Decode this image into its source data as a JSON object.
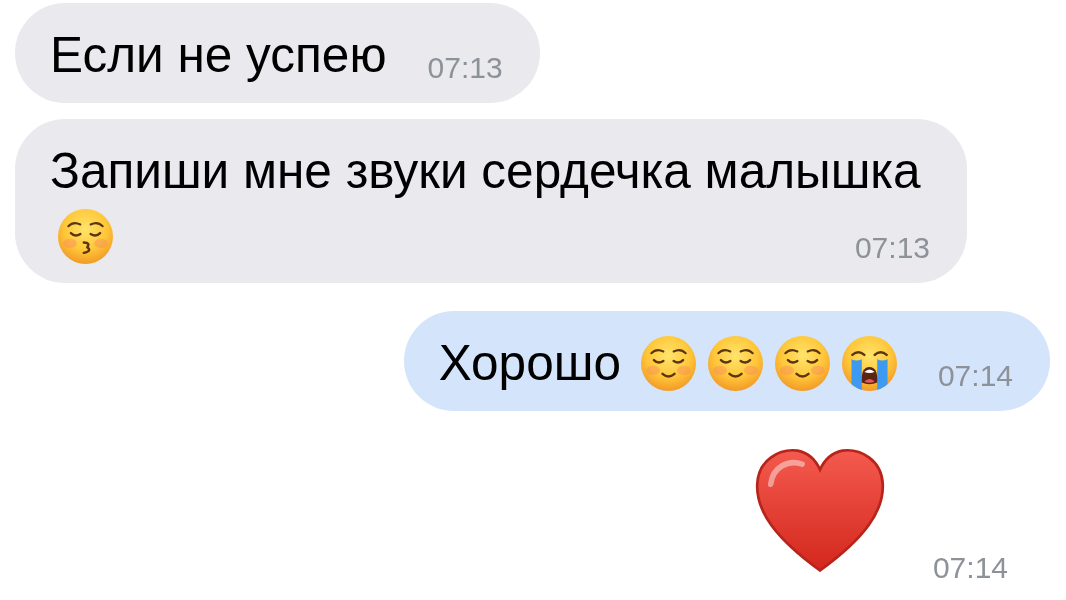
{
  "messages": [
    {
      "outgoing": false,
      "kind": "text",
      "text": "Если не успею",
      "time": "07:13"
    },
    {
      "outgoing": false,
      "kind": "text",
      "text": "Запиши мне звуки сердечка малышка",
      "emoji": [
        {
          "kind": "kissing_face"
        }
      ],
      "time": "07:13"
    },
    {
      "outgoing": true,
      "kind": "text",
      "text": "Хорошо",
      "emoji": [
        {
          "kind": "smiling_face"
        },
        {
          "kind": "smiling_face"
        },
        {
          "kind": "smiling_face"
        },
        {
          "kind": "crying_face"
        }
      ],
      "time": "07:14"
    },
    {
      "outgoing": true,
      "kind": "big_emoji",
      "emoji": [
        {
          "kind": "heart"
        }
      ],
      "time": "07:14"
    }
  ]
}
